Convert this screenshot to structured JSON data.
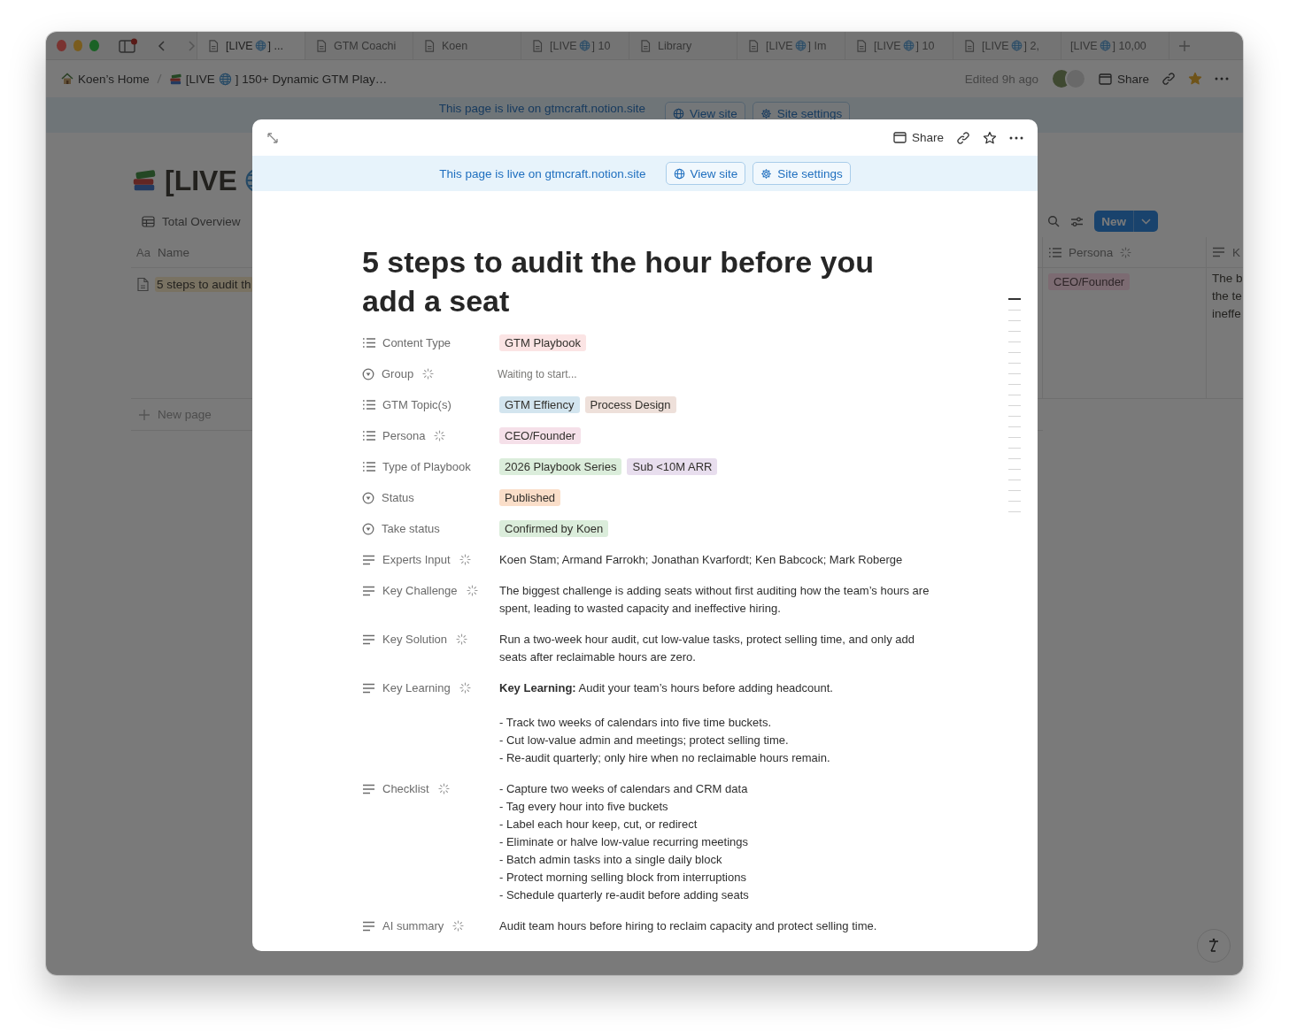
{
  "window": {
    "tabs": [
      {
        "label": "[LIVE",
        "globe": true,
        "after": "] ...",
        "icon": true,
        "selected": true
      },
      {
        "label": "GTM Coachi",
        "globe": false,
        "icon": true,
        "selected": false
      },
      {
        "label": "Koen",
        "globe": false,
        "icon": true,
        "selected": false
      },
      {
        "label": "[LIVE",
        "globe": true,
        "after": "] 10",
        "icon": true,
        "selected": false
      },
      {
        "label": "Library",
        "globe": false,
        "icon": true,
        "selected": false
      },
      {
        "label": "[LIVE",
        "globe": true,
        "after": "] Im",
        "icon": true,
        "selected": false
      },
      {
        "label": "[LIVE",
        "globe": true,
        "after": "] 10",
        "icon": true,
        "selected": false
      },
      {
        "label": "[LIVE",
        "globe": true,
        "after": "] 2,",
        "icon": true,
        "selected": false
      },
      {
        "label": "[LIVE",
        "globe": true,
        "after": "] 10,00",
        "icon": false,
        "selected": false
      }
    ]
  },
  "topbar": {
    "breadcrumbs": [
      {
        "label": "Koen’s Home",
        "globe": false
      },
      {
        "label": "[LIVE",
        "globe": true,
        "after": "] 150+ Dynamic GTM Play…"
      }
    ],
    "edited": "Edited 9h ago",
    "share": "Share",
    "favorite": true
  },
  "background_page": {
    "banner": {
      "text": "This page is live on gtmcraft.notion.site",
      "view": "View site",
      "settings": "Site settings"
    },
    "title": "[LIVE",
    "view_tab": "Total Overview",
    "new_button": "New",
    "columns": [
      {
        "kind": "title",
        "glyph": "Aa",
        "label": "Name",
        "ai": false
      },
      {
        "kind": "multi_select",
        "label": "Persona",
        "ai": true
      },
      {
        "kind": "text",
        "label": "K",
        "ai": false
      }
    ],
    "rows": [
      {
        "name": "5 steps to audit th",
        "selected": true,
        "persona": {
          "text": "CEO/Founder",
          "color": "#7c6b72"
        },
        "column_3": [
          "The b",
          "the te",
          "ineffe"
        ]
      }
    ],
    "new_page": "New page"
  },
  "modal": {
    "share": "Share",
    "favorite": false,
    "banner": {
      "text": "This page is live on gtmcraft.notion.site",
      "view": "View site",
      "settings": "Site settings"
    },
    "title": "5 steps to audit the hour before you add a seat",
    "properties": [
      {
        "kind": "multi_select",
        "label": "Content Type",
        "ai": false,
        "tags": [
          {
            "text": "GTM Playbook",
            "color": "#fbe4e4"
          }
        ]
      },
      {
        "kind": "status",
        "label": "Group",
        "ai": true,
        "note": "Waiting to start..."
      },
      {
        "kind": "multi_select",
        "label": "GTM Topic(s)",
        "ai": false,
        "tags": [
          {
            "text": "GTM Effiency",
            "color": "#d3e5ef"
          },
          {
            "text": "Process Design",
            "color": "#eee0da"
          }
        ]
      },
      {
        "kind": "multi_select",
        "label": "Persona",
        "ai": true,
        "tags": [
          {
            "text": "CEO/Founder",
            "color": "#f5e0e9"
          }
        ]
      },
      {
        "kind": "multi_select",
        "label": "Type of Playbook",
        "ai": false,
        "tags": [
          {
            "text": "2026 Playbook Series",
            "color": "#dbeddb"
          },
          {
            "text": "Sub <10M ARR",
            "color": "#e8deee"
          }
        ]
      },
      {
        "kind": "status",
        "label": "Status",
        "ai": false,
        "tags": [
          {
            "text": "Published",
            "color": "#fadec9"
          }
        ]
      },
      {
        "kind": "status",
        "label": "Take status",
        "ai": false,
        "tags": [
          {
            "text": "Confirmed by Koen",
            "color": "#dbeddb"
          }
        ]
      },
      {
        "kind": "text",
        "label": "Experts Input",
        "ai": true,
        "blocks": [
          [
            "Koen Stam; Armand Farrokh; Jonathan Kvarfordt; Ken Babcock; Mark Roberge"
          ]
        ]
      },
      {
        "kind": "text",
        "label": "Key Challenge",
        "ai": true,
        "blocks": [
          [
            "The biggest challenge is adding seats without first auditing how the team’s hours are spent, leading to wasted capacity and ineffective hiring."
          ]
        ]
      },
      {
        "kind": "text",
        "label": "Key Solution",
        "ai": true,
        "blocks": [
          [
            "Run a two-week hour audit, cut low-value tasks, protect selling time, and only add seats after reclaimable hours are zero."
          ]
        ]
      },
      {
        "kind": "text",
        "label": "Key Learning",
        "ai": true,
        "blocks": [
          [
            "**Key Learning:** Audit your team’s hours before adding headcount."
          ],
          [
            "- Track two weeks of calendars into five time buckets.",
            "- Cut low-value admin and meetings; protect selling time.",
            "- Re-audit quarterly; only hire when no reclaimable hours remain."
          ]
        ]
      },
      {
        "kind": "text",
        "label": "Checklist",
        "ai": true,
        "blocks": [
          [
            "- Capture two weeks of calendars and CRM data",
            "- Tag every hour into five buckets",
            "- Label each hour keep, cut, or redirect",
            "- Eliminate or halve low-value recurring meetings",
            "- Batch admin tasks into a single daily block",
            "- Protect morning selling block from interruptions",
            "- Schedule quarterly re-audit before adding seats"
          ]
        ]
      },
      {
        "kind": "text",
        "label": "AI summary",
        "ai": true,
        "blocks": [
          [
            "Audit team hours before hiring to reclaim capacity and protect selling time."
          ]
        ]
      }
    ]
  }
}
